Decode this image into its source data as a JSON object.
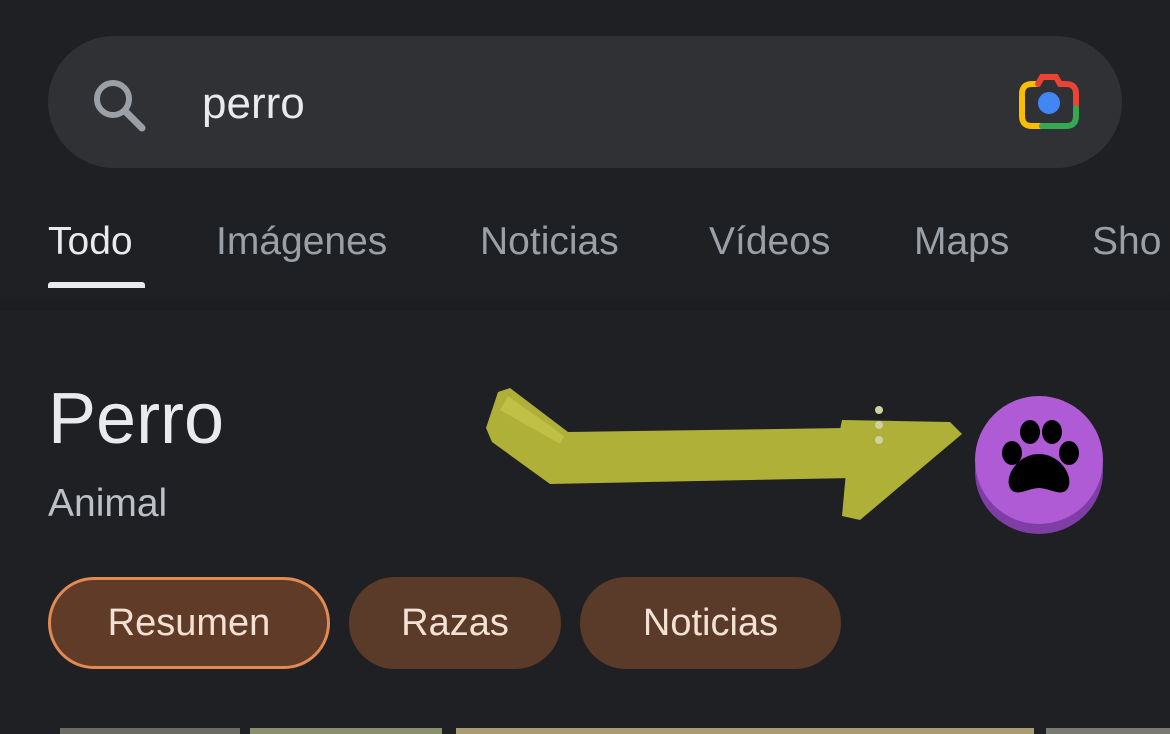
{
  "search": {
    "query": "perro",
    "search_icon": "search-icon",
    "lens_icon": "google-lens-icon"
  },
  "tabs": [
    {
      "label": "Todo",
      "active": true
    },
    {
      "label": "Imágenes",
      "active": false
    },
    {
      "label": "Noticias",
      "active": false
    },
    {
      "label": "Vídeos",
      "active": false
    },
    {
      "label": "Maps",
      "active": false
    },
    {
      "label": "Sho",
      "active": false
    }
  ],
  "entity": {
    "title": "Perro",
    "subtitle": "Animal",
    "badge_icon": "paw-icon",
    "badge_color": "#b05bd6"
  },
  "chips": [
    {
      "label": "Resumen",
      "selected": true
    },
    {
      "label": "Razas",
      "selected": false
    },
    {
      "label": "Noticias",
      "selected": false
    }
  ],
  "annotation": {
    "icon": "arrow-icon",
    "color": "#c8c83a"
  },
  "colors": {
    "background": "#1f2023",
    "search_bar": "#303134",
    "chip": "#5a3a28",
    "chip_border_selected": "#e38a52"
  }
}
